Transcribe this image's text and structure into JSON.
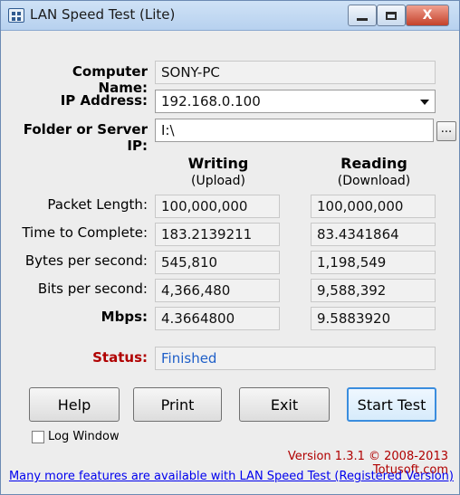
{
  "window": {
    "title": "LAN Speed Test (Lite)",
    "close_glyph": "X"
  },
  "info": {
    "computer_name_label": "Computer Name:",
    "computer_name_value": "SONY-PC",
    "ip_address_label": "IP Address:",
    "ip_address_value": "192.168.0.100",
    "folder_label": "Folder or Server IP:",
    "folder_value": "I:\\",
    "browse_label": "..."
  },
  "columns": {
    "writing_title": "Writing",
    "writing_sub": "(Upload)",
    "reading_title": "Reading",
    "reading_sub": "(Download)"
  },
  "metrics": [
    {
      "label": "Packet Length:",
      "writing": "100,000,000",
      "reading": "100,000,000"
    },
    {
      "label": "Time to Complete:",
      "writing": "183.2139211",
      "reading": "83.4341864"
    },
    {
      "label": "Bytes per second:",
      "writing": "545,810",
      "reading": "1,198,549"
    },
    {
      "label": "Bits per second:",
      "writing": "4,366,480",
      "reading": "9,588,392"
    },
    {
      "label": "Mbps:",
      "writing": "4.3664800",
      "reading": "9.5883920"
    }
  ],
  "status": {
    "label": "Status:",
    "value": "Finished",
    "label_color": "#b00000",
    "value_color": "#1f5fc8"
  },
  "buttons": {
    "help": "Help",
    "print": "Print",
    "exit": "Exit",
    "start_test": "Start Test"
  },
  "log_window": {
    "label": "Log Window",
    "checked": false
  },
  "footer": {
    "version": "Version 1.3.1 © 2008-2013 Totusoft.com",
    "link": "Many more features are available with LAN Speed Test (Registered Version)"
  }
}
